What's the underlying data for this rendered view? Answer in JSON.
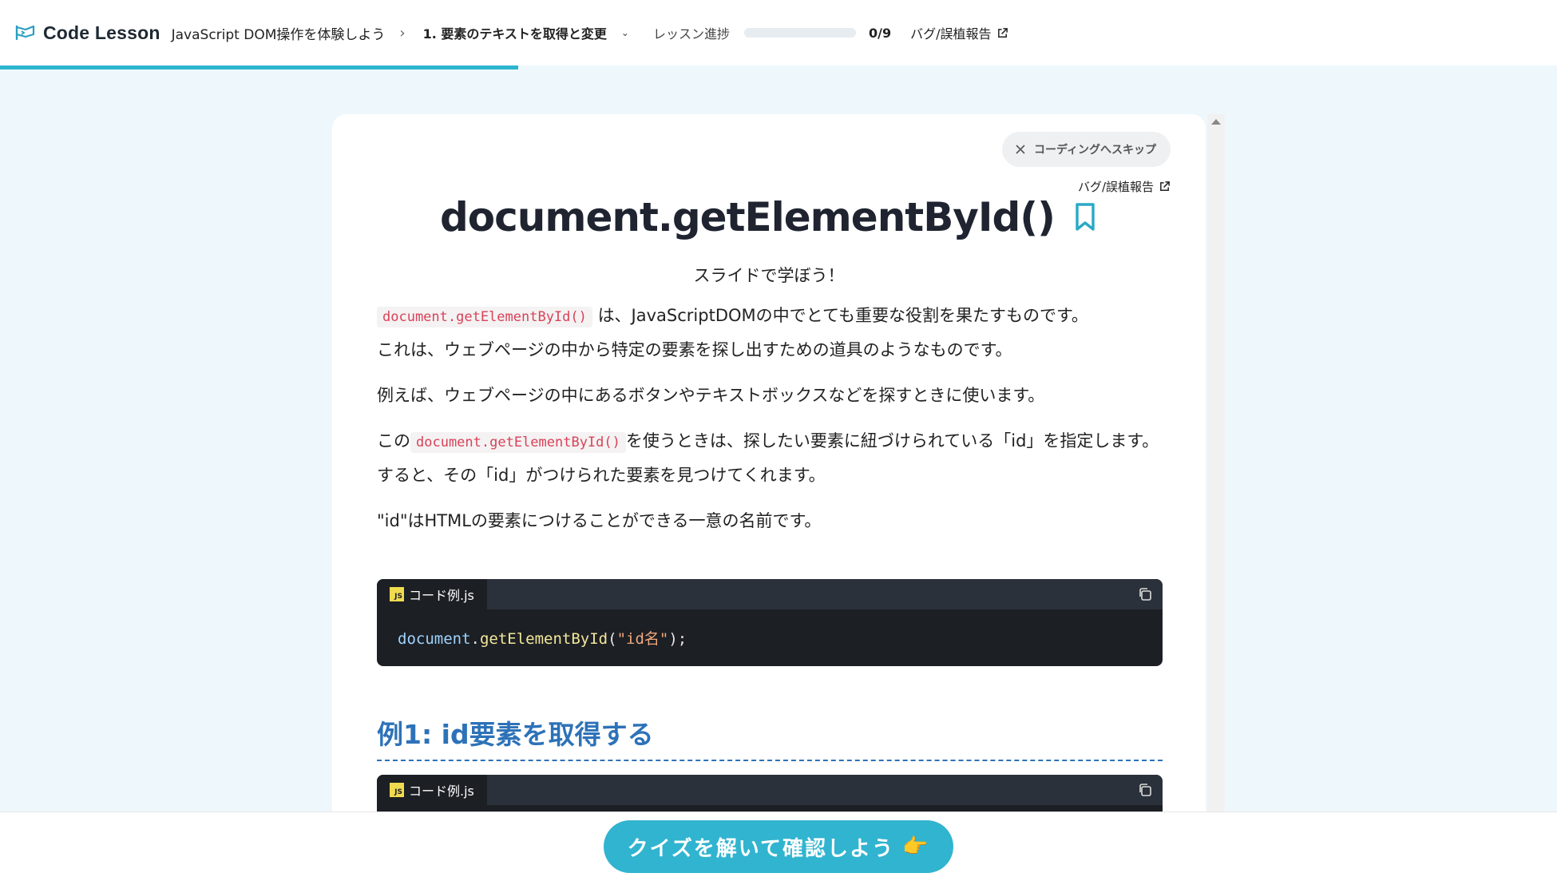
{
  "header": {
    "logo_text": "Code Lesson",
    "course_title": "JavaScript DOM操作を体験しよう",
    "breadcrumb_sep": "›",
    "lesson_title": "1. 要素のテキストを取得と変更",
    "lesson_caret": "⌄",
    "progress_label": "レッスン進捗",
    "progress_value": 0,
    "progress_count": "0/9",
    "report_label": "バグ/誤植報告"
  },
  "page_progress": 0.333,
  "card": {
    "skip_label": "コーディングへスキップ",
    "report_label": "バグ/誤植報告",
    "title": "document.getElementById()",
    "subtitle": "スライドで学ぼう！",
    "p1_code": "document.getElementById()",
    "p1_text": "は、JavaScriptDOMの中でとても重要な役割を果たすものです。",
    "p1_text2": "これは、ウェブページの中から特定の要素を探し出すための道具のようなものです。",
    "p2": "例えば、ウェブページの中にあるボタンやテキストボックスなどを探すときに使います。",
    "p3_pre": "この",
    "p3_code": "document.getElementById()",
    "p3_text": "を使うときは、探したい要素に紐づけられている「id」を指定します。",
    "p3_text2": "すると、その「id」がつけられた要素を見つけてくれます。",
    "p4": "\"id\"はHTMLの要素につけることができる一意の名前です。",
    "code1": {
      "icon_label": "JS",
      "filename": "コード例.js",
      "tok_obj": "document",
      "tok_dot": ".",
      "tok_fn": "getElementById",
      "tok_open": "(",
      "tok_str": "\"id名\"",
      "tok_close": ");"
    },
    "section_heading": "例1: id要素を取得する",
    "code2": {
      "icon_label": "JS",
      "filename": "コード例.js"
    }
  },
  "footer": {
    "quiz_label": "クイズを解いて確認しよう",
    "quiz_emoji": "👉"
  },
  "colors": {
    "accent": "#31b4cf",
    "heading_blue": "#2d72b8",
    "inline_code": "#d9425a",
    "code_bg": "#1c1f24"
  }
}
